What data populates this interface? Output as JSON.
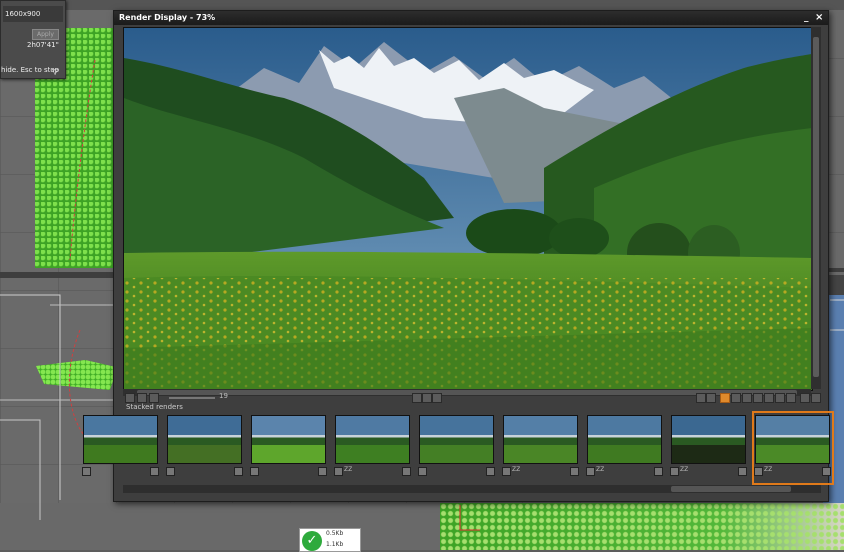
{
  "render_settings": {
    "resolution": "1600x900",
    "apply_label": "Apply",
    "time": "2h07'41\"",
    "hint": "hide. Esc to stop"
  },
  "render_display": {
    "title": "Render Display - 73%",
    "minimize_glyph": "_",
    "close_glyph": "×",
    "zoom_value": "19",
    "stacked_label": "Stacked renders",
    "thumbnails": [
      {
        "label": "",
        "selected": false
      },
      {
        "label": "",
        "selected": false
      },
      {
        "label": "",
        "selected": false
      },
      {
        "label": "ZZ",
        "selected": false
      },
      {
        "label": "",
        "selected": false
      },
      {
        "label": "ZZ",
        "selected": false
      },
      {
        "label": "ZZ",
        "selected": false
      },
      {
        "label": "ZZ",
        "selected": false
      },
      {
        "label": "ZZ",
        "selected": true
      }
    ]
  },
  "status_widget": {
    "line1": "0.5Kb",
    "line2": "1.1Kb"
  },
  "colors": {
    "accent": "#e07a1a",
    "status_ok": "#2eaa3c"
  }
}
